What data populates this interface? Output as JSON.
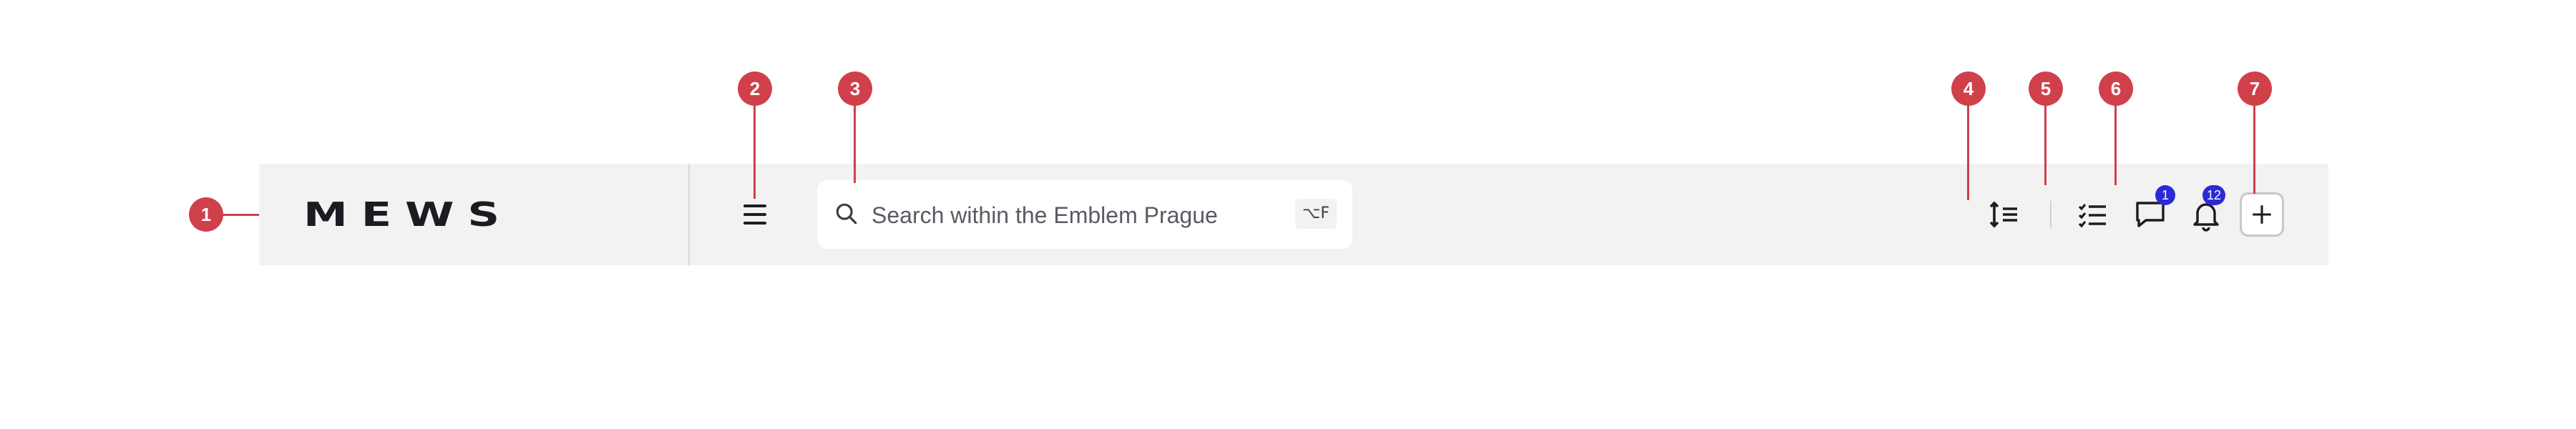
{
  "header": {
    "logo_text": "MEWS",
    "search": {
      "placeholder": "Search within the Emblem Prague",
      "shortcut": "⌥F"
    },
    "messages_badge": "1",
    "notifications_badge": "12",
    "icons": [
      "menu-icon",
      "search-icon",
      "line-height-icon",
      "checklist-icon",
      "chat-icon",
      "bell-icon",
      "plus-icon"
    ]
  },
  "annotations": {
    "markers": [
      "1",
      "2",
      "3",
      "4",
      "5",
      "6",
      "7"
    ],
    "color": "#d0404a"
  },
  "colors": {
    "header_bg": "#f2f2f2",
    "badge": "#2a2ad9",
    "text": "#1c1b22"
  }
}
